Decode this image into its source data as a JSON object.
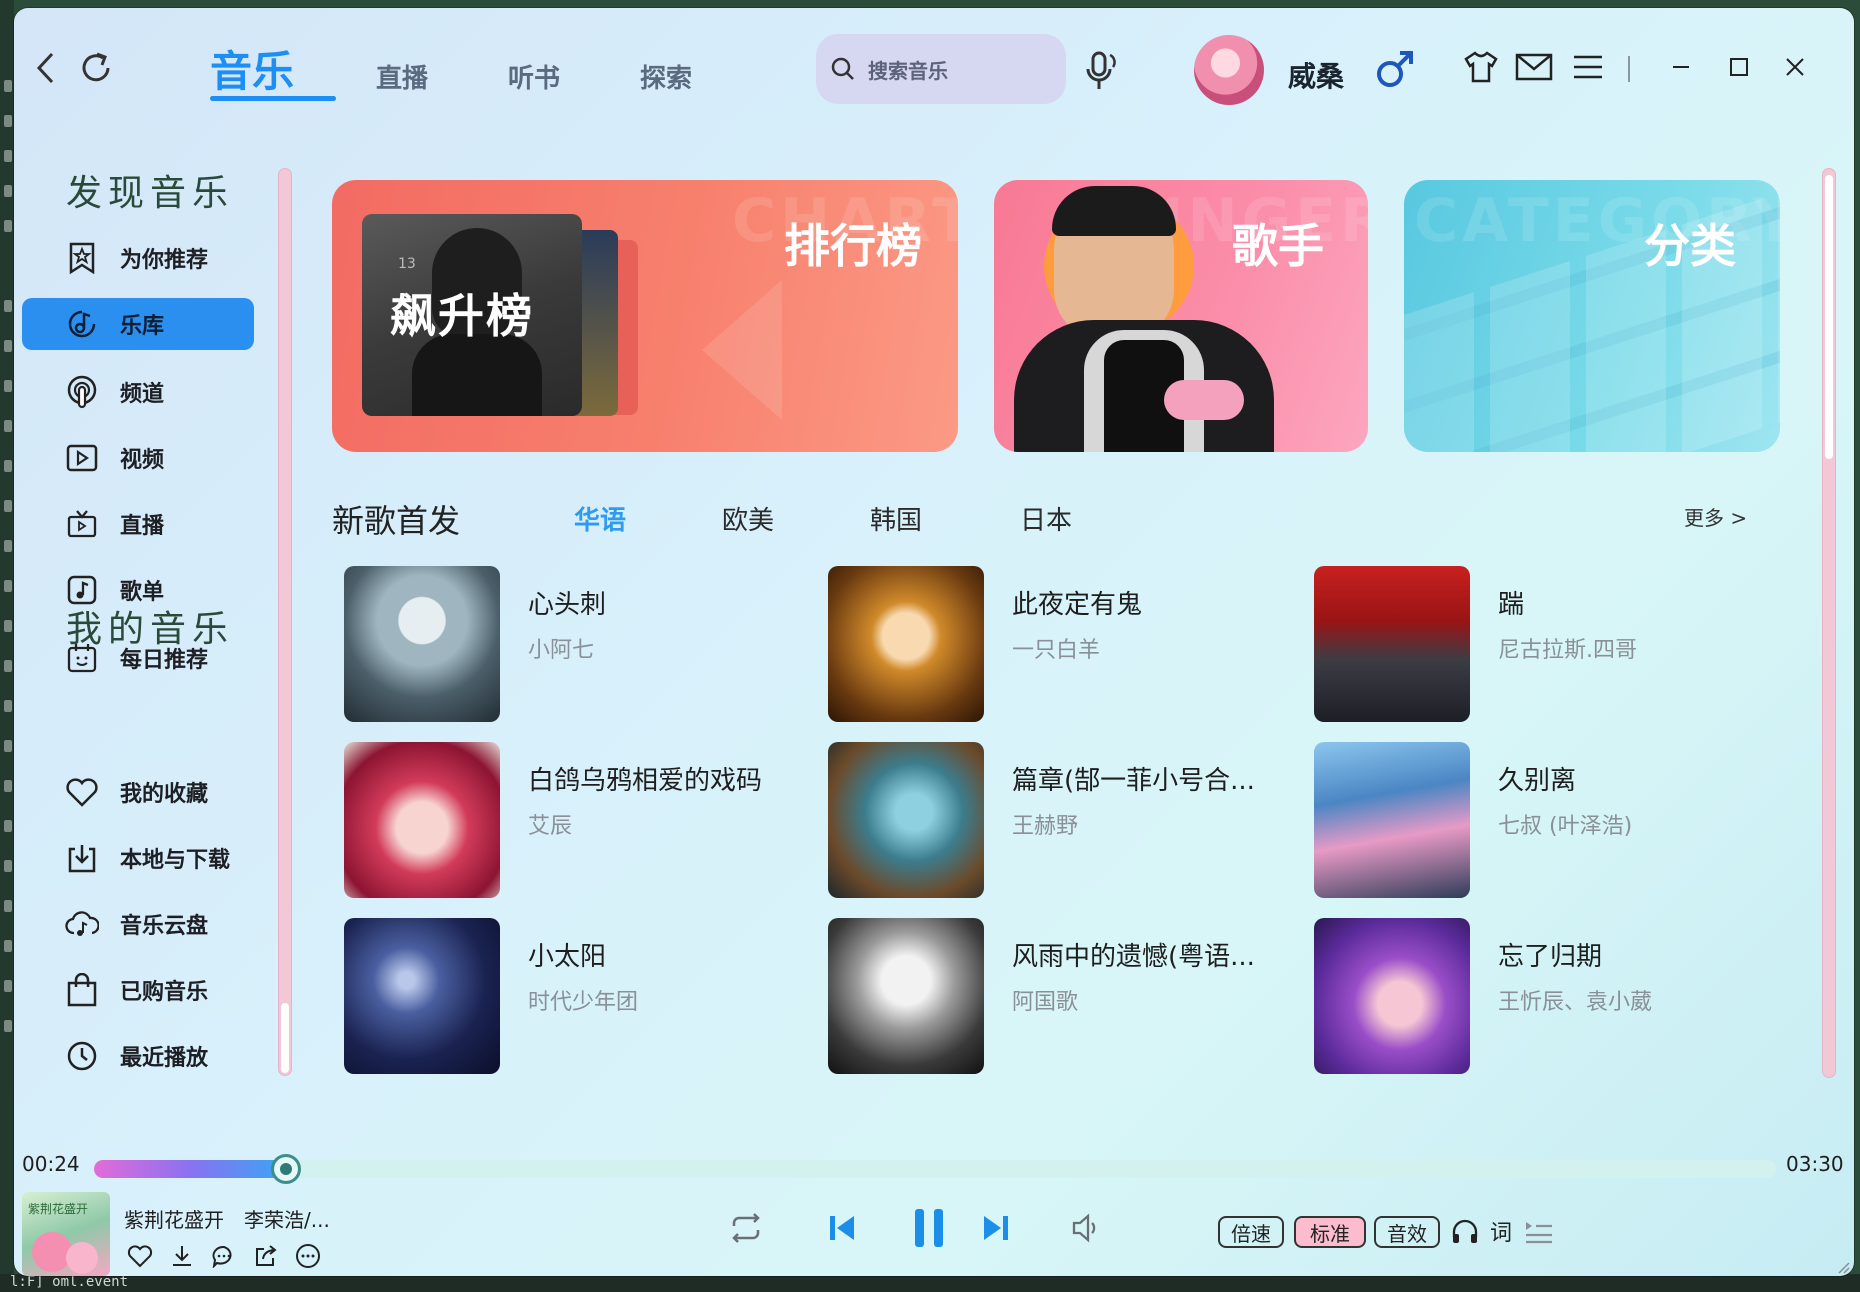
{
  "header": {
    "tabs": [
      {
        "label": "音乐",
        "active": true
      },
      {
        "label": "直播"
      },
      {
        "label": "听书"
      },
      {
        "label": "探索"
      }
    ],
    "search_placeholder": "搜索音乐",
    "username": "威桑"
  },
  "sidebar": {
    "discover_heading": "发现音乐",
    "discover_items": [
      {
        "label": "为你推荐",
        "icon": "star-bookmark-icon"
      },
      {
        "label": "乐库",
        "icon": "music-note-disc-icon",
        "active": true
      },
      {
        "label": "频道",
        "icon": "podcast-icon"
      },
      {
        "label": "视频",
        "icon": "video-play-icon"
      },
      {
        "label": "直播",
        "icon": "tv-icon"
      },
      {
        "label": "歌单",
        "icon": "playlist-note-icon"
      },
      {
        "label": "每日推荐",
        "icon": "calendar-smile-icon"
      }
    ],
    "mine_heading": "我的音乐",
    "mine_items": [
      {
        "label": "我的收藏",
        "icon": "heart-icon"
      },
      {
        "label": "本地与下载",
        "icon": "download-icon"
      },
      {
        "label": "音乐云盘",
        "icon": "cloud-music-icon"
      },
      {
        "label": "已购音乐",
        "icon": "shopping-bag-icon"
      },
      {
        "label": "最近播放",
        "icon": "clock-icon"
      }
    ]
  },
  "banners": {
    "chart": {
      "title": "排行榜",
      "ghost": "CHART",
      "card_text": "飙升榜",
      "card_small": "13"
    },
    "singer": {
      "title": "歌手",
      "ghost": "SINGER"
    },
    "category": {
      "title": "分类",
      "ghost": "CATEGORY"
    }
  },
  "new_songs": {
    "title": "新歌首发",
    "tabs": [
      "华语",
      "欧美",
      "韩国",
      "日本"
    ],
    "active_tab": "华语",
    "more": "更多 >",
    "songs": [
      {
        "title": "心头刺",
        "artist": "小阿七"
      },
      {
        "title": "此夜定有鬼",
        "artist": "一只白羊"
      },
      {
        "title": "踹",
        "artist": "尼古拉斯.四哥"
      },
      {
        "title": "白鸽乌鸦相爱的戏码",
        "artist": "艾辰"
      },
      {
        "title": "篇章(郜一菲小号合...",
        "artist": "王赫野"
      },
      {
        "title": "久别离",
        "artist": "七叔 (叶泽浩)"
      },
      {
        "title": "小太阳",
        "artist": "时代少年团"
      },
      {
        "title": "风雨中的遗憾(粤语...",
        "artist": "阿国歌"
      },
      {
        "title": "忘了归期",
        "artist": "王忻辰、袁小葳"
      }
    ]
  },
  "player": {
    "elapsed": "00:24",
    "duration": "03:30",
    "progress": 0.114,
    "now_playing": "紫荆花盛开　李荣浩/...",
    "cover_text": "紫荆花盛开",
    "speed_label": "倍速",
    "quality_label": "标准",
    "effect_label": "音效",
    "lyrics_label": "词"
  },
  "bottom_terminal_text": "l:F] oml.event",
  "colors": {
    "accent": "#1c8ef4",
    "sidebar_active": "#2b8ff0",
    "chart_banner": "#f77a6f",
    "singer_banner": "#f98aa7",
    "category_banner": "#6ed4e6"
  }
}
